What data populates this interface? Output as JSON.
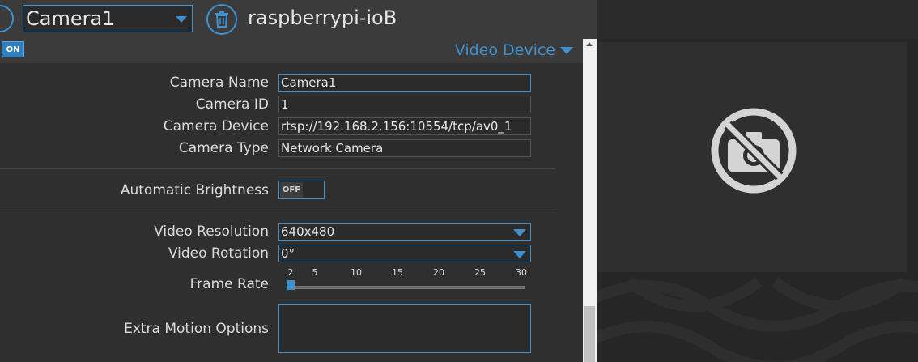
{
  "header": {
    "camera_selected": "Camera1",
    "host_name": "raspberrypi-ioB"
  },
  "section": {
    "toggle_label": "ON",
    "title": "Video Device"
  },
  "fields": {
    "camera_name_label": "Camera Name",
    "camera_name_value": "Camera1",
    "camera_id_label": "Camera ID",
    "camera_id_value": "1",
    "camera_device_label": "Camera Device",
    "camera_device_value": "rtsp://192.168.2.156:10554/tcp/av0_1",
    "camera_type_label": "Camera Type",
    "camera_type_value": "Network Camera",
    "auto_brightness_label": "Automatic Brightness",
    "auto_brightness_value": "OFF",
    "video_resolution_label": "Video Resolution",
    "video_resolution_value": "640x480",
    "video_rotation_label": "Video Rotation",
    "video_rotation_value": "0°",
    "frame_rate_label": "Frame Rate",
    "frame_rate_ticks": [
      "2",
      "5",
      "10",
      "15",
      "20",
      "25",
      "30"
    ],
    "frame_rate_value": 2,
    "extra_motion_label": "Extra Motion Options",
    "extra_motion_value": ""
  },
  "preview": {
    "icon": "no-camera-icon"
  },
  "colors": {
    "accent": "#3f90cf",
    "panel": "#2f2f2f",
    "header": "#3b3b3b"
  }
}
